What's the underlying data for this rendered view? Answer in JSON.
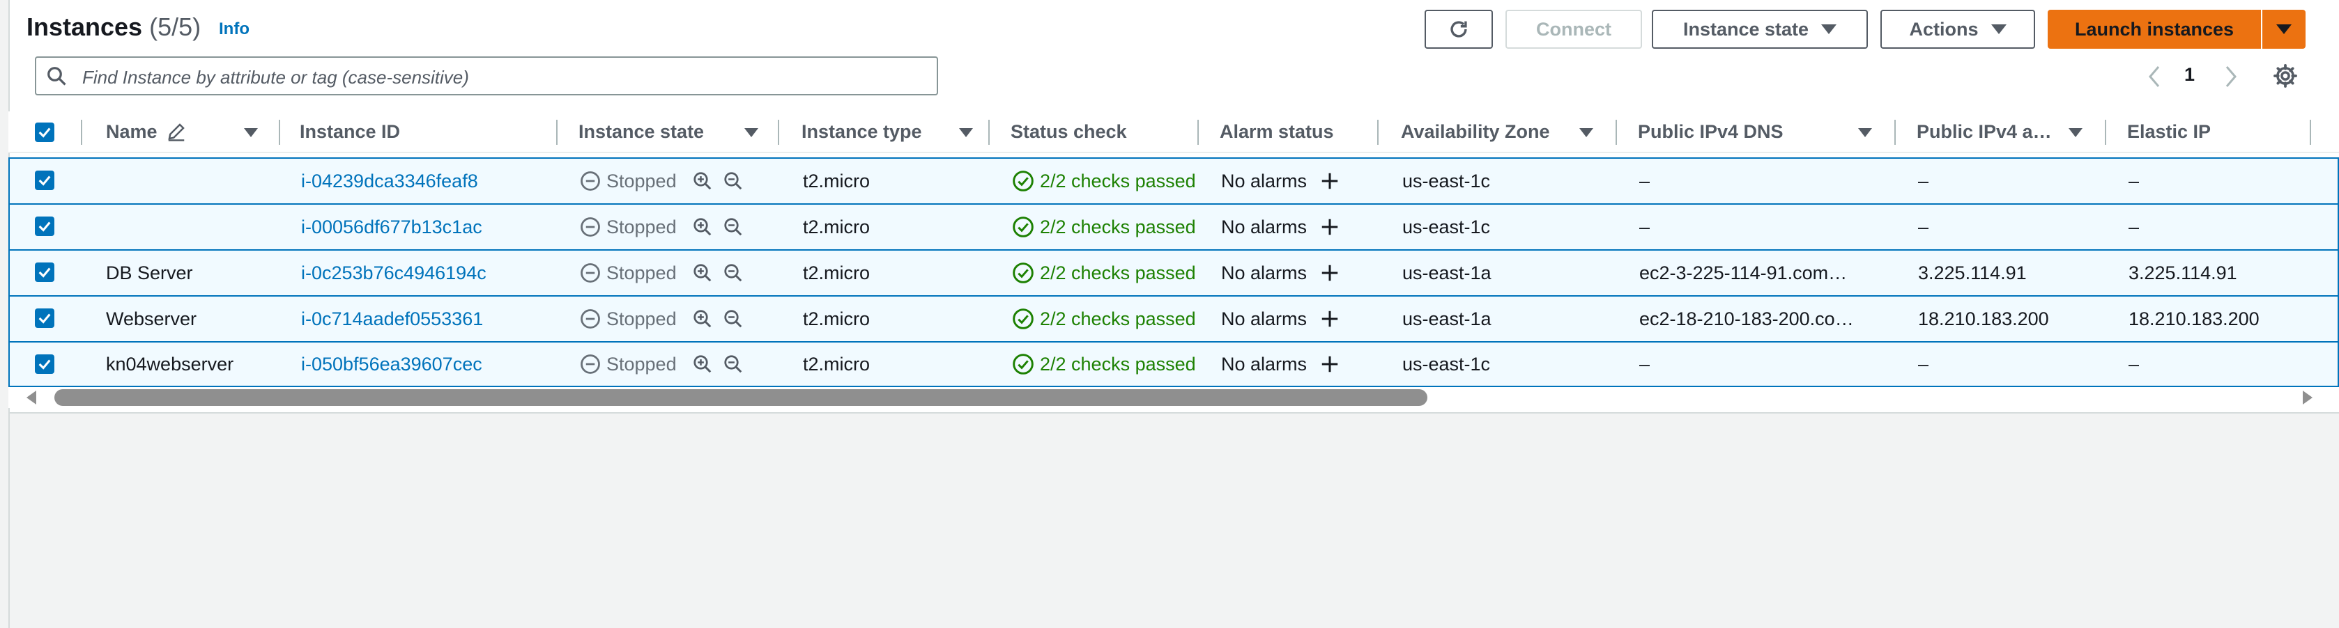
{
  "header": {
    "title": "Instances",
    "count": "(5/5)",
    "info_label": "Info"
  },
  "search": {
    "placeholder": "Find Instance by attribute or tag (case-sensitive)",
    "value": ""
  },
  "toolbar": {
    "connect_label": "Connect",
    "instance_state_label": "Instance state",
    "actions_label": "Actions",
    "launch_label": "Launch instances"
  },
  "pagination": {
    "current_page": "1"
  },
  "columns": [
    "Name",
    "Instance ID",
    "Instance state",
    "Instance type",
    "Status check",
    "Alarm status",
    "Availability Zone",
    "Public IPv4 DNS",
    "Public IPv4 a…",
    "Elastic IP"
  ],
  "rows": [
    {
      "name": "",
      "id": "i-04239dca3346feaf8",
      "state": "Stopped",
      "type": "t2.micro",
      "status": "2/2 checks passed",
      "alarm": "No alarms",
      "az": "us-east-1c",
      "dns": "–",
      "ipv4": "–",
      "eip": "–"
    },
    {
      "name": "",
      "id": "i-00056df677b13c1ac",
      "state": "Stopped",
      "type": "t2.micro",
      "status": "2/2 checks passed",
      "alarm": "No alarms",
      "az": "us-east-1c",
      "dns": "–",
      "ipv4": "–",
      "eip": "–"
    },
    {
      "name": "DB Server",
      "id": "i-0c253b76c4946194c",
      "state": "Stopped",
      "type": "t2.micro",
      "status": "2/2 checks passed",
      "alarm": "No alarms",
      "az": "us-east-1a",
      "dns": "ec2-3-225-114-91.com…",
      "ipv4": "3.225.114.91",
      "eip": "3.225.114.91"
    },
    {
      "name": "Webserver",
      "id": "i-0c714aadef0553361",
      "state": "Stopped",
      "type": "t2.micro",
      "status": "2/2 checks passed",
      "alarm": "No alarms",
      "az": "us-east-1a",
      "dns": "ec2-18-210-183-200.co…",
      "ipv4": "18.210.183.200",
      "eip": "18.210.183.200"
    },
    {
      "name": "kn04webserver",
      "id": "i-050bf56ea39607cec",
      "state": "Stopped",
      "type": "t2.micro",
      "status": "2/2 checks passed",
      "alarm": "No alarms",
      "az": "us-east-1c",
      "dns": "–",
      "ipv4": "–",
      "eip": "–"
    }
  ],
  "colors": {
    "accent": "#0073bb",
    "primary_button": "#ec7211",
    "success": "#1d8102",
    "selected_row_bg": "#f1faff"
  },
  "icons": {
    "refresh": "refresh-icon",
    "search": "search-icon",
    "settings": "gear-icon",
    "edit": "pencil-icon",
    "stopped": "minus-circle-icon",
    "zoom_in": "zoom-in-icon",
    "zoom_out": "zoom-out-icon",
    "check": "check-circle-icon",
    "add_alarm": "plus-icon"
  }
}
